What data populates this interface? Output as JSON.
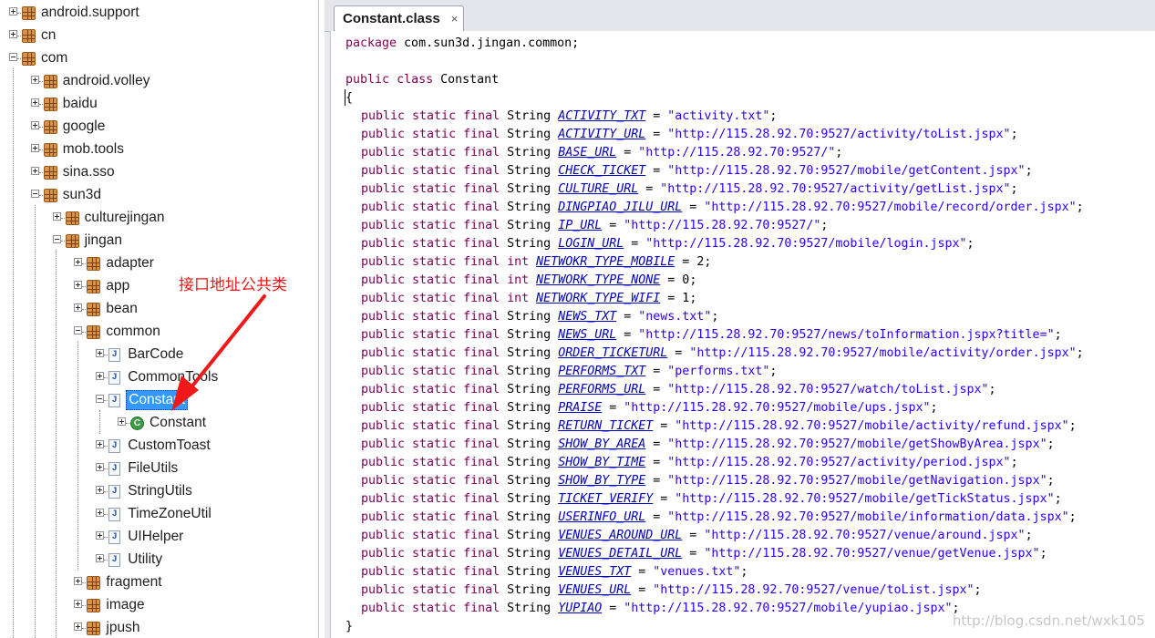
{
  "tree": {
    "items": [
      {
        "label": "android.support",
        "icon": "package-icon",
        "expander": "plus"
      },
      {
        "label": "cn",
        "icon": "package-icon",
        "expander": "plus"
      },
      {
        "label": "com",
        "icon": "package-icon",
        "expander": "minus"
      },
      {
        "label": "android.volley",
        "icon": "package-icon",
        "expander": "plus"
      },
      {
        "label": "baidu",
        "icon": "package-icon",
        "expander": "plus"
      },
      {
        "label": "google",
        "icon": "package-icon",
        "expander": "plus"
      },
      {
        "label": "mob.tools",
        "icon": "package-icon",
        "expander": "plus"
      },
      {
        "label": "sina.sso",
        "icon": "package-icon",
        "expander": "plus"
      },
      {
        "label": "sun3d",
        "icon": "package-icon",
        "expander": "minus"
      },
      {
        "label": "culturejingan",
        "icon": "package-icon",
        "expander": "plus"
      },
      {
        "label": "jingan",
        "icon": "package-icon",
        "expander": "minus"
      },
      {
        "label": "adapter",
        "icon": "package-icon",
        "expander": "plus"
      },
      {
        "label": "app",
        "icon": "package-icon",
        "expander": "plus"
      },
      {
        "label": "bean",
        "icon": "package-icon",
        "expander": "plus"
      },
      {
        "label": "common",
        "icon": "package-icon",
        "expander": "minus"
      },
      {
        "label": "BarCode",
        "icon": "java-file-icon",
        "expander": "plus"
      },
      {
        "label": "CommonTools",
        "icon": "java-file-icon",
        "expander": "plus"
      },
      {
        "label": "Constant",
        "icon": "java-file-icon",
        "expander": "minus",
        "selected": true
      },
      {
        "label": "Constant",
        "icon": "class-icon",
        "expander": "plus"
      },
      {
        "label": "CustomToast",
        "icon": "java-file-icon",
        "expander": "plus"
      },
      {
        "label": "FileUtils",
        "icon": "java-file-icon",
        "expander": "plus"
      },
      {
        "label": "StringUtils",
        "icon": "java-file-icon",
        "expander": "plus"
      },
      {
        "label": "TimeZoneUtil",
        "icon": "java-file-icon",
        "expander": "plus"
      },
      {
        "label": "UIHelper",
        "icon": "java-file-icon",
        "expander": "plus"
      },
      {
        "label": "Utility",
        "icon": "java-file-icon",
        "expander": "plus"
      },
      {
        "label": "fragment",
        "icon": "package-icon",
        "expander": "plus"
      },
      {
        "label": "image",
        "icon": "package-icon",
        "expander": "plus"
      },
      {
        "label": "jpush",
        "icon": "package-icon",
        "expander": "plus"
      }
    ]
  },
  "annotation": {
    "text": "接口地址公共类",
    "color": "#f01818"
  },
  "editor": {
    "tab_title": "Constant.class",
    "tab_close": "×",
    "package_line": {
      "keyword": "package",
      "rest": " com.sun3d.jingan.common;"
    },
    "class_line": {
      "kw1": "public",
      "kw2": "class",
      "name": "Constant"
    },
    "open_brace": "{",
    "close_brace": "}",
    "modifiers": "public static final",
    "fields": [
      {
        "type": "String",
        "name": "ACTIVITY_TXT",
        "value": "\"activity.txt\""
      },
      {
        "type": "String",
        "name": "ACTIVITY_URL",
        "value": "\"http://115.28.92.70:9527/activity/toList.jspx\""
      },
      {
        "type": "String",
        "name": "BASE_URL",
        "value": "\"http://115.28.92.70:9527/\""
      },
      {
        "type": "String",
        "name": "CHECK_TICKET",
        "value": "\"http://115.28.92.70:9527/mobile/getContent.jspx\""
      },
      {
        "type": "String",
        "name": "CULTURE_URL",
        "value": "\"http://115.28.92.70:9527/activity/getList.jspx\""
      },
      {
        "type": "String",
        "name": "DINGPIAO_JILU_URL",
        "value": "\"http://115.28.92.70:9527/mobile/record/order.jspx\""
      },
      {
        "type": "String",
        "name": "IP_URL",
        "value": "\"http://115.28.92.70:9527/\""
      },
      {
        "type": "String",
        "name": "LOGIN_URL",
        "value": "\"http://115.28.92.70:9527/mobile/login.jspx\""
      },
      {
        "type": "int",
        "name": "NETWOKR_TYPE_MOBILE",
        "value": "2"
      },
      {
        "type": "int",
        "name": "NETWORK_TYPE_NONE",
        "value": "0"
      },
      {
        "type": "int",
        "name": "NETWORK_TYPE_WIFI",
        "value": "1"
      },
      {
        "type": "String",
        "name": "NEWS_TXT",
        "value": "\"news.txt\""
      },
      {
        "type": "String",
        "name": "NEWS_URL",
        "value": "\"http://115.28.92.70:9527/news/toInformation.jspx?title=\""
      },
      {
        "type": "String",
        "name": "ORDER_TICKETURL",
        "value": "\"http://115.28.92.70:9527/mobile/activity/order.jspx\""
      },
      {
        "type": "String",
        "name": "PERFORMS_TXT",
        "value": "\"performs.txt\""
      },
      {
        "type": "String",
        "name": "PERFORMS_URL",
        "value": "\"http://115.28.92.70:9527/watch/toList.jspx\""
      },
      {
        "type": "String",
        "name": "PRAISE",
        "value": "\"http://115.28.92.70:9527/mobile/ups.jspx\""
      },
      {
        "type": "String",
        "name": "RETURN_TICKET",
        "value": "\"http://115.28.92.70:9527/mobile/activity/refund.jspx\""
      },
      {
        "type": "String",
        "name": "SHOW_BY_AREA",
        "value": "\"http://115.28.92.70:9527/mobile/getShowByArea.jspx\""
      },
      {
        "type": "String",
        "name": "SHOW_BY_TIME",
        "value": "\"http://115.28.92.70:9527/activity/period.jspx\""
      },
      {
        "type": "String",
        "name": "SHOW_BY_TYPE",
        "value": "\"http://115.28.92.70:9527/mobile/getNavigation.jspx\""
      },
      {
        "type": "String",
        "name": "TICKET_VERIFY",
        "value": "\"http://115.28.92.70:9527/mobile/getTickStatus.jspx\""
      },
      {
        "type": "String",
        "name": "USERINFO_URL",
        "value": "\"http://115.28.92.70:9527/mobile/information/data.jspx\""
      },
      {
        "type": "String",
        "name": "VENUES_AROUND_URL",
        "value": "\"http://115.28.92.70:9527/venue/around.jspx\""
      },
      {
        "type": "String",
        "name": "VENUES_DETAIL_URL",
        "value": "\"http://115.28.92.70:9527/venue/getVenue.jspx\""
      },
      {
        "type": "String",
        "name": "VENUES_TXT",
        "value": "\"venues.txt\""
      },
      {
        "type": "String",
        "name": "VENUES_URL",
        "value": "\"http://115.28.92.70:9527/venue/toList.jspx\""
      },
      {
        "type": "String",
        "name": "YUPIAO",
        "value": "\"http://115.28.92.70:9527/mobile/yupiao.jspx\""
      }
    ],
    "watermark": "http://blog.csdn.net/wxk105"
  }
}
